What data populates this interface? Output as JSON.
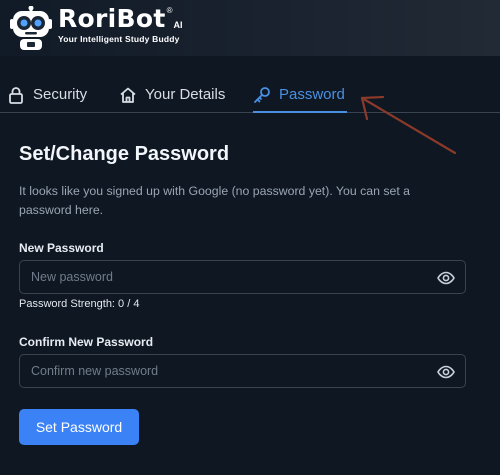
{
  "header": {
    "brand_name": "RoriBot",
    "brand_registered": "®",
    "brand_suffix": "AI",
    "tagline": "Your Intelligent Study Buddy",
    "logo_icon": "robot-icon"
  },
  "tabs": [
    {
      "label": "Security",
      "icon": "lock-icon",
      "active": false
    },
    {
      "label": "Your Details",
      "icon": "home-icon",
      "active": false
    },
    {
      "label": "Password",
      "icon": "key-icon",
      "active": true
    }
  ],
  "content": {
    "title": "Set/Change Password",
    "description": "It looks like you signed up with Google (no password yet). You can set a password here.",
    "new_password": {
      "label": "New Password",
      "placeholder": "New password",
      "value": ""
    },
    "strength_text": "Password Strength: 0 / 4",
    "confirm_password": {
      "label": "Confirm New Password",
      "placeholder": "Confirm new password",
      "value": ""
    },
    "submit_label": "Set Password"
  },
  "colors": {
    "background": "#0f1722",
    "accent": "#3b82f6",
    "active_tab": "#4a90e2",
    "annotation_arrow": "#8b3a2a"
  }
}
